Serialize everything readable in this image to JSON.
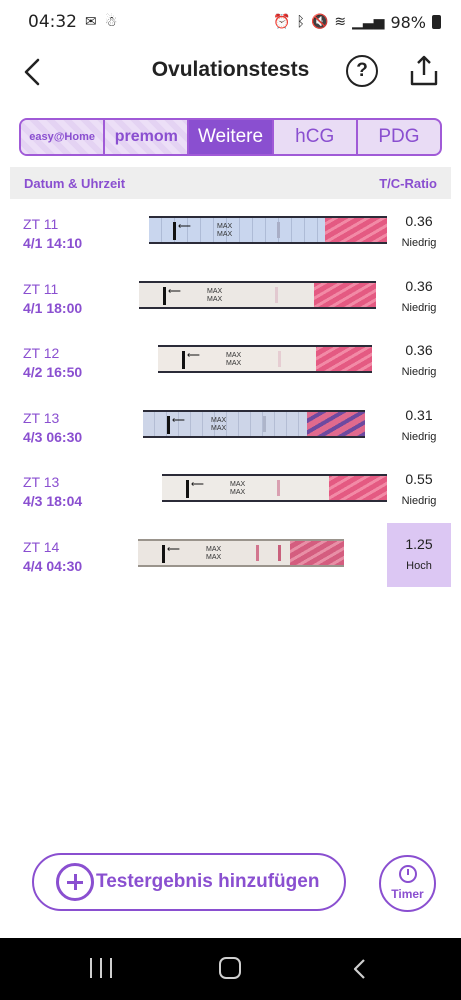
{
  "status_bar": {
    "time": "04:32",
    "battery": "98%"
  },
  "header": {
    "title": "Ovulationstests",
    "help_label": "?"
  },
  "tabs": [
    {
      "label": "easy@Home",
      "active": false
    },
    {
      "label": "premom",
      "active": false
    },
    {
      "label": "Weitere",
      "active": true
    },
    {
      "label": "hCG",
      "active": false
    },
    {
      "label": "PDG",
      "active": false
    }
  ],
  "table": {
    "col_date": "Datum & Uhrzeit",
    "col_ratio": "T/C-Ratio",
    "rows": [
      {
        "cycle_day": "ZT 11",
        "datetime": "4/1  14:10",
        "ratio": "0.36",
        "level": "Niedrig",
        "high": false
      },
      {
        "cycle_day": "ZT 11",
        "datetime": "4/1  18:00",
        "ratio": "0.36",
        "level": "Niedrig",
        "high": false
      },
      {
        "cycle_day": "ZT 12",
        "datetime": "4/2  16:50",
        "ratio": "0.36",
        "level": "Niedrig",
        "high": false
      },
      {
        "cycle_day": "ZT 13",
        "datetime": "4/3  06:30",
        "ratio": "0.31",
        "level": "Niedrig",
        "high": false
      },
      {
        "cycle_day": "ZT 13",
        "datetime": "4/3  18:04",
        "ratio": "0.55",
        "level": "Niedrig",
        "high": false
      },
      {
        "cycle_day": "ZT 14",
        "datetime": "4/4  04:30",
        "ratio": "1.25",
        "level": "Hoch",
        "high": true
      }
    ],
    "strip_max_text": "MAX"
  },
  "actions": {
    "add_label": "Testergebnis hinzufügen",
    "timer_label": "Timer"
  },
  "colors": {
    "accent": "#8a4fd0",
    "high_bg": "#dcc7f3",
    "header_bg": "#eeeeee"
  }
}
